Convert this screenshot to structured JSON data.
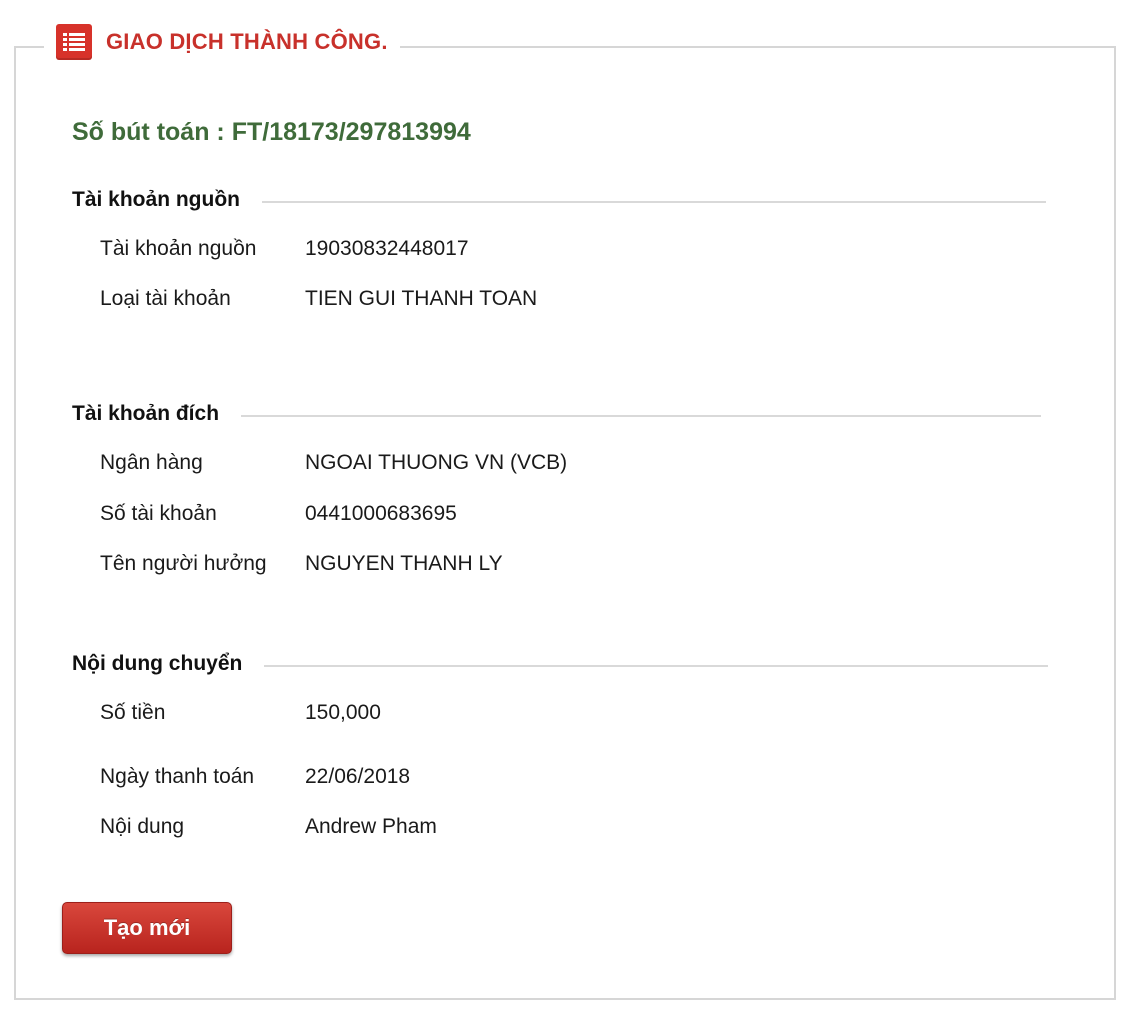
{
  "header": {
    "title": "GIAO DỊCH THÀNH CÔNG.",
    "icon": "list-icon",
    "accent_color": "#c8312b"
  },
  "reference": {
    "label": "Số bút toán : ",
    "value": "FT/18173/297813994",
    "color": "#3f6b3a"
  },
  "source_account": {
    "title": "Tài khoản nguồn",
    "rows": [
      {
        "label": "Tài khoản nguồn",
        "value": "19030832448017"
      },
      {
        "label": "Loại tài khoản",
        "value": "TIEN GUI THANH TOAN"
      }
    ]
  },
  "destination_account": {
    "title": "Tài khoản đích",
    "rows": [
      {
        "label": "Ngân hàng",
        "value": "NGOAI THUONG VN (VCB)"
      },
      {
        "label": "Số tài khoản",
        "value": "0441000683695"
      },
      {
        "label": "Tên người hưởng",
        "value": "NGUYEN THANH LY"
      }
    ]
  },
  "transfer_content": {
    "title": "Nội dung chuyển",
    "rows": [
      {
        "label": "Số tiền",
        "value": "150,000"
      },
      {
        "label": "Ngày thanh toán",
        "value": "22/06/2018"
      },
      {
        "label": "Nội dung",
        "value": "Andrew Pham"
      }
    ]
  },
  "actions": {
    "new_button_label": "Tạo mới"
  }
}
